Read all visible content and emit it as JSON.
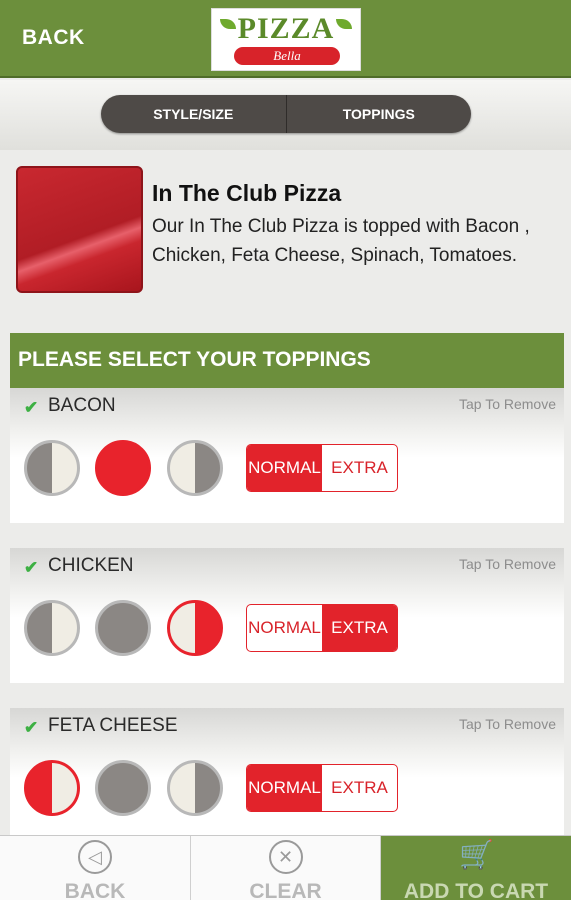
{
  "header": {
    "back_label": "BACK",
    "logo": {
      "word": "PIZZA",
      "script": "Bella"
    }
  },
  "tabs": [
    {
      "label": "STYLE/SIZE"
    },
    {
      "label": "TOPPINGS"
    }
  ],
  "product": {
    "title": "In The Club Pizza",
    "description": "Our In The Club Pizza is topped with Bacon , Chicken, Feta Cheese, Spinach, Tomatoes."
  },
  "toppings_section": {
    "heading": "PLEASE SELECT YOUR TOPPINGS",
    "remove_label": "Tap To Remove",
    "normal_label": "NORMAL",
    "extra_label": "EXTRA",
    "items": [
      {
        "name": "BACON",
        "placement": "whole",
        "amount": "normal"
      },
      {
        "name": "CHICKEN",
        "placement": "right",
        "amount": "extra"
      },
      {
        "name": "FETA CHEESE",
        "placement": "left",
        "amount": "normal"
      }
    ]
  },
  "footer": {
    "back_label": "BACK",
    "clear_label": "CLEAR",
    "cart_label": "ADD TO CART"
  },
  "colors": {
    "brand_green": "#6c8f3c",
    "accent_red": "#e2232b",
    "segmented_dark": "#4e4a47"
  }
}
